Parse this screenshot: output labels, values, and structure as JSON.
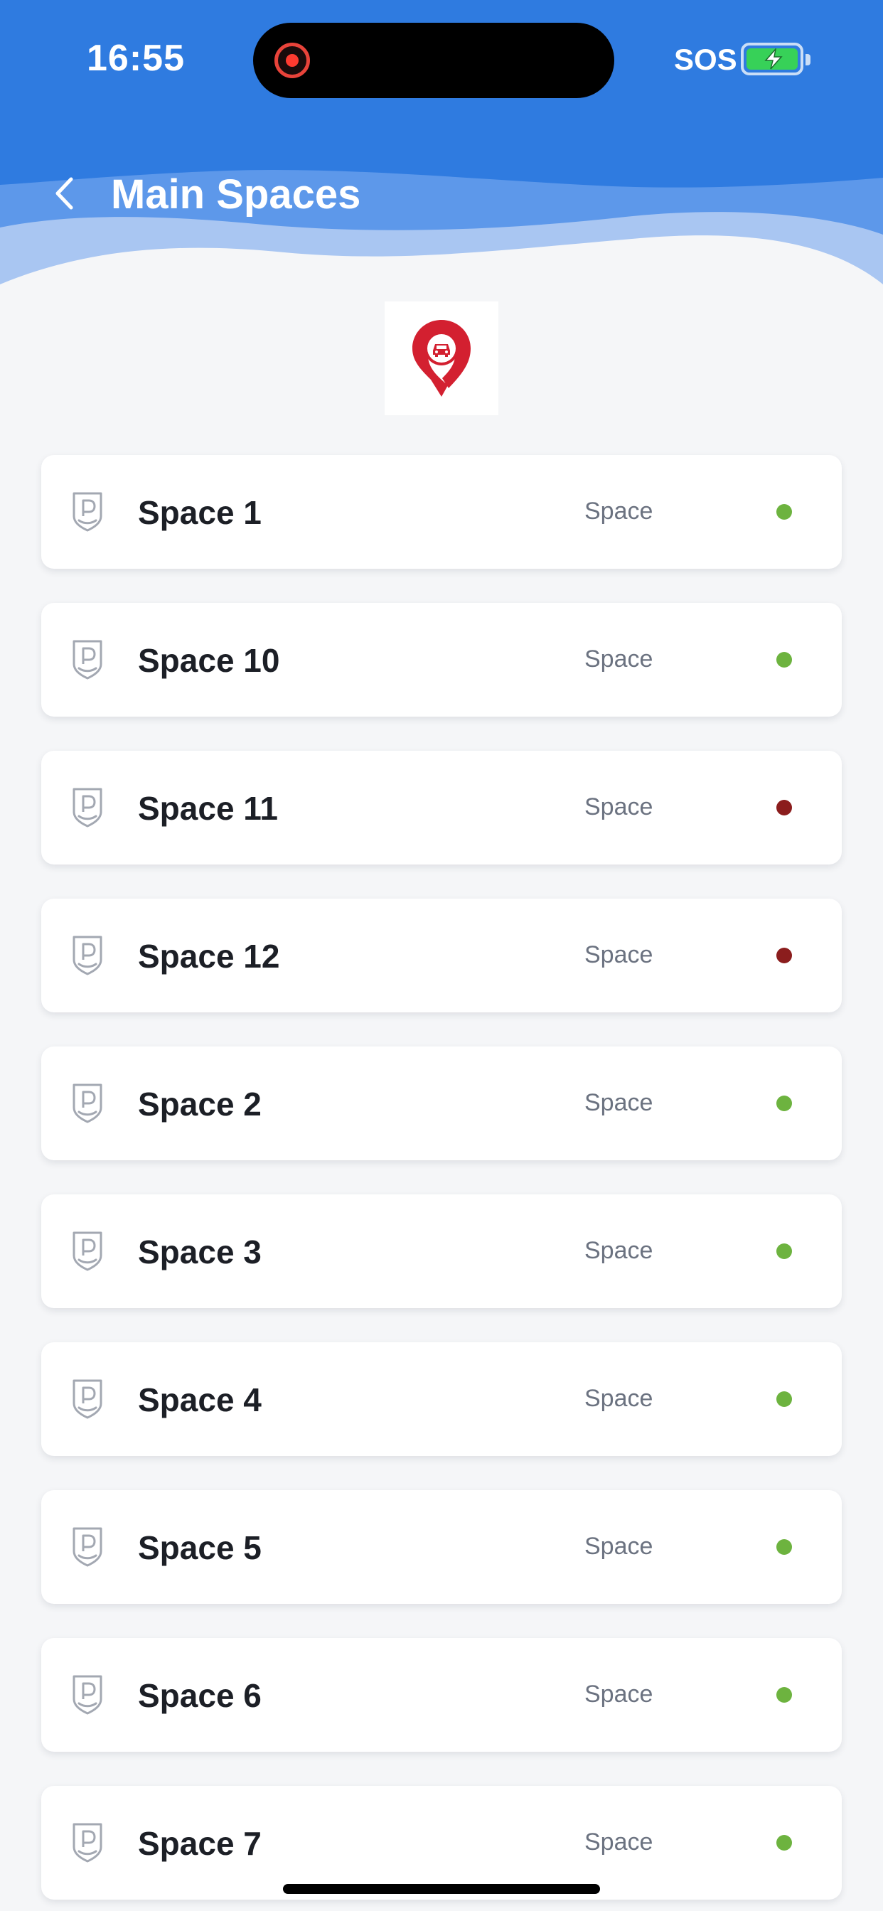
{
  "status_bar": {
    "time": "16:55",
    "carrier_text": "SOS",
    "recording_icon": "screen-recording-icon",
    "battery_icon": "battery-charging-icon"
  },
  "header": {
    "title": "Main Spaces",
    "back_icon": "chevron-left-icon",
    "background_color": "#2f7be0"
  },
  "logo": {
    "icon": "map-pin-car-icon",
    "color": "#d32030"
  },
  "colors": {
    "status_available": "#6db33f",
    "status_occupied": "#8b1d1d"
  },
  "spaces": [
    {
      "name": "Space 1",
      "type": "Space",
      "status": "available"
    },
    {
      "name": "Space 10",
      "type": "Space",
      "status": "available"
    },
    {
      "name": "Space 11",
      "type": "Space",
      "status": "occupied"
    },
    {
      "name": "Space 12",
      "type": "Space",
      "status": "occupied"
    },
    {
      "name": "Space 2",
      "type": "Space",
      "status": "available"
    },
    {
      "name": "Space 3",
      "type": "Space",
      "status": "available"
    },
    {
      "name": "Space 4",
      "type": "Space",
      "status": "available"
    },
    {
      "name": "Space 5",
      "type": "Space",
      "status": "available"
    },
    {
      "name": "Space 6",
      "type": "Space",
      "status": "available"
    },
    {
      "name": "Space 7",
      "type": "Space",
      "status": "available"
    }
  ]
}
